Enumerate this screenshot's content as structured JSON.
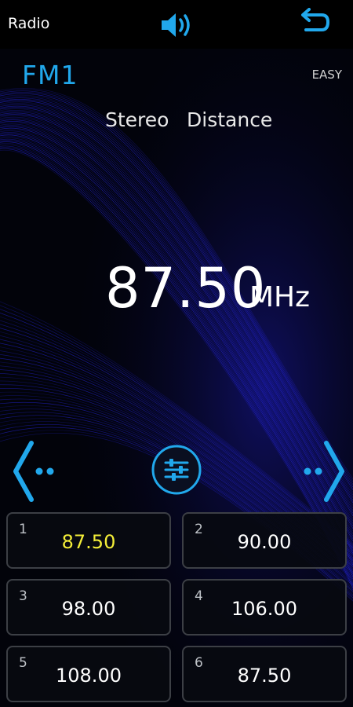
{
  "app": {
    "title": "Radio"
  },
  "icons": {
    "volume": "speaker-volume-icon",
    "back": "back-return-icon",
    "prev": "chevron-left-icon",
    "next": "chevron-right-icon",
    "equalizer": "equalizer-sliders-icon"
  },
  "tuner": {
    "band": "FM1",
    "easy_label": "EASY",
    "stereo_label": "Stereo",
    "distance_label": "Distance",
    "frequency": "87.50",
    "unit": "MHz"
  },
  "presets": [
    {
      "num": "1",
      "freq": "87.50",
      "active": true
    },
    {
      "num": "2",
      "freq": "90.00",
      "active": false
    },
    {
      "num": "3",
      "freq": "98.00",
      "active": false
    },
    {
      "num": "4",
      "freq": "106.00",
      "active": false
    },
    {
      "num": "5",
      "freq": "108.00",
      "active": false
    },
    {
      "num": "6",
      "freq": "87.50",
      "active": false
    }
  ],
  "colors": {
    "accent": "#21a8ec",
    "active_preset": "#f4ee38",
    "wave": "#2a2aff"
  }
}
